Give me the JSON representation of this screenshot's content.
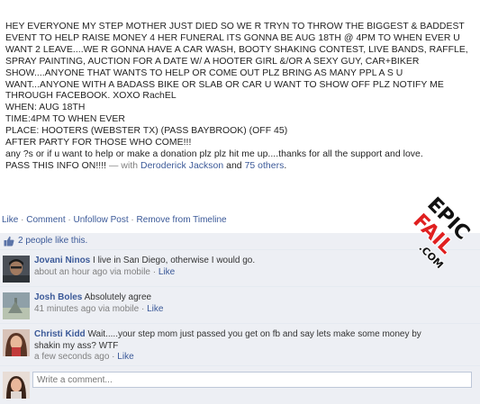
{
  "post": {
    "text": "HEY EVERYONE MY STEP MOTHER JUST DIED SO WE R TRYN TO THROW THE BIGGEST & BADDEST EVENT TO HELP RAISE MONEY 4 HER FUNERAL ITS GONNA BE AUG 18TH @ 4PM TO WHEN EVER U WANT 2 LEAVE....WE R GONNA HAVE A CAR WASH, BOOTY SHAKING CONTEST, LIVE BANDS, RAFFLE, SPRAY PAINTING, AUCTION FOR A DATE W/ A HOOTER GIRL &/OR A SEXY GUY, CAR+BIKER SHOW....ANYONE THAT WANTS TO HELP OR COME OUT PLZ BRING AS MANY PPL A S U WANT...ANYONE WITH A BADASS BIKE OR SLAB OR CAR U WANT TO SHOW OFF PLZ NOTIFY ME THROUGH FACEBOOK. XOXO RachEL\nWHEN: AUG 18TH\nTIME:4PM TO WHEN EVER\nPLACE: HOOTERS (WEBSTER TX) (PASS BAYBROOK) (OFF 45)\nAFTER PARTY FOR THOSE WHO COME!!!\nany ?s or if u want to help or make a donation plz plz hit me up....thanks for all the support and love.\nPASS THIS INFO ON!!!!",
    "with_prefix": " — with ",
    "tagged": "Deroderick Jackson",
    "and": " and ",
    "others": "75 others",
    "period": "."
  },
  "actions": {
    "like": "Like",
    "comment": "Comment",
    "unfollow": "Unfollow Post",
    "remove": "Remove from Timeline",
    "sep": " · "
  },
  "likes": {
    "text": "2 people like this."
  },
  "comments": [
    {
      "name": "Jovani Ninos",
      "text": "I live in San Diego, otherwise I would go.",
      "time": "about an hour ago via mobile",
      "like": "Like"
    },
    {
      "name": "Josh Boles",
      "text": "Absolutely agree",
      "time": "41 minutes ago via mobile",
      "like": "Like"
    },
    {
      "name": "Christi Kidd",
      "text": "Wait.....your step mom just passed you get on fb and say lets make some money by shakin my ass? WTF",
      "time": "a few seconds ago",
      "like": "Like"
    }
  ],
  "write_comment": {
    "placeholder": "Write a comment..."
  },
  "watermark": {
    "line1": "EPIC",
    "line2": "FAIL",
    "domain": ".COM"
  }
}
